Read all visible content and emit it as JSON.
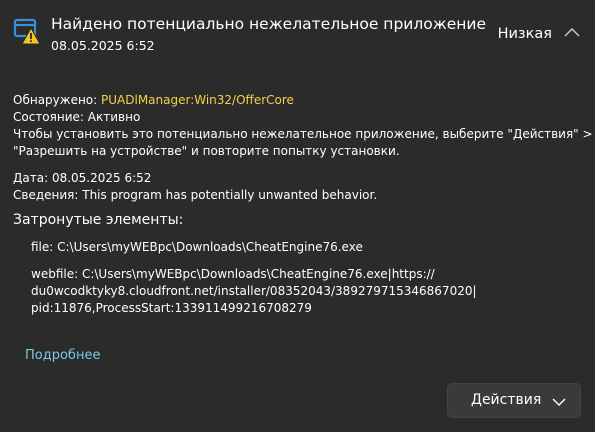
{
  "header": {
    "title": "Найдено потенциально нежелательное приложение",
    "date": "08.05.2025 6:52",
    "severity": "Низкая"
  },
  "details": {
    "detected_label": "Обнаружено:",
    "detected_value": "PUADlManager:Win32/OfferCore",
    "status_label": "Состояние:",
    "status_value": "Активно",
    "instruction_line1": "Чтобы установить это потенциально нежелательное приложение, выберите \"Действия\" >",
    "instruction_line2": "\"Разрешить на устройстве\" и повторите попытку установки.",
    "date_label": "Дата:",
    "date_value": "08.05.2025 6:52",
    "info_label": "Сведения:",
    "info_value": "This program has potentially unwanted behavior."
  },
  "affected": {
    "heading": "Затронутые элементы:",
    "items": [
      [
        "file: C:\\Users\\myWEBpc\\Downloads\\CheatEngine76.exe"
      ],
      [
        "webfile: C:\\Users\\myWEBpc\\Downloads\\CheatEngine76.exe|https://",
        "du0wcodktyky8.cloudfront.net/installer/08352043/389279715346867020|",
        "pid:11876,ProcessStart:133911499216708279"
      ]
    ]
  },
  "links": {
    "more": "Подробнее"
  },
  "actions": {
    "label": "Действия"
  },
  "colors": {
    "background": "#2b2b2b",
    "threat_name": "#f1d247",
    "link": "#7ec8e3",
    "shield_blue": "#3a8fd8",
    "warning_yellow": "#f3c623"
  },
  "icons": {
    "app": "shield-warning-icon",
    "collapse": "chevron-up-icon",
    "actions": "chevron-down-icon"
  }
}
